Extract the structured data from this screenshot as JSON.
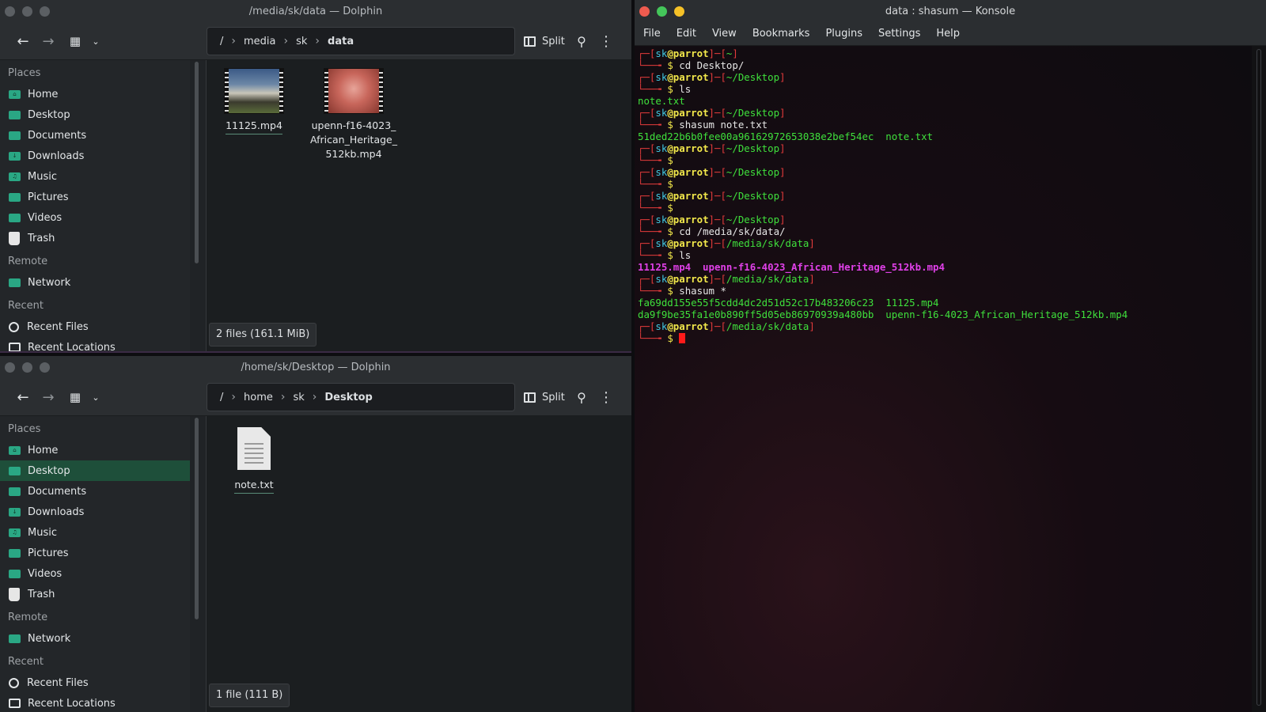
{
  "dolphin_top": {
    "title": "/media/sk/data — Dolphin",
    "breadcrumb": [
      "/",
      "media",
      "sk",
      "data"
    ],
    "split_label": "Split",
    "places_label": "Places",
    "remote_label": "Remote",
    "recent_label": "Recent",
    "places": [
      "Home",
      "Desktop",
      "Documents",
      "Downloads",
      "Music",
      "Pictures",
      "Videos",
      "Trash"
    ],
    "remote": [
      "Network"
    ],
    "recent": [
      "Recent Files",
      "Recent Locations"
    ],
    "files": [
      {
        "name": "11125.mp4"
      },
      {
        "name_lines": [
          "upenn-f16-4023_",
          "African_Heritage_",
          "512kb.mp4"
        ]
      }
    ],
    "status": "2 files (161.1 MiB)"
  },
  "dolphin_bottom": {
    "title": "/home/sk/Desktop — Dolphin",
    "breadcrumb": [
      "/",
      "home",
      "sk",
      "Desktop"
    ],
    "split_label": "Split",
    "places_label": "Places",
    "remote_label": "Remote",
    "recent_label": "Recent",
    "places": [
      "Home",
      "Desktop",
      "Documents",
      "Downloads",
      "Music",
      "Pictures",
      "Videos",
      "Trash"
    ],
    "remote": [
      "Network"
    ],
    "recent": [
      "Recent Files",
      "Recent Locations"
    ],
    "active_place": "Desktop",
    "files": [
      {
        "name": "note.txt"
      }
    ],
    "status": "1 file (111 B)"
  },
  "konsole": {
    "title": "data : shasum — Konsole",
    "menu": [
      "File",
      "Edit",
      "View",
      "Bookmarks",
      "Plugins",
      "Settings",
      "Help"
    ],
    "user": "sk",
    "host": "parrot",
    "blocks": [
      {
        "path": "~",
        "cmd": "cd Desktop/",
        "out": []
      },
      {
        "path": "~/Desktop",
        "cmd": "ls",
        "out": [
          "note.txt"
        ]
      },
      {
        "path": "~/Desktop",
        "cmd": "shasum note.txt",
        "out": [
          "51ded22b6b0fee00a96162972653038e2bef54ec  note.txt"
        ]
      },
      {
        "path": "~/Desktop",
        "cmd": "",
        "out": []
      },
      {
        "path": "~/Desktop",
        "cmd": "",
        "out": []
      },
      {
        "path": "~/Desktop",
        "cmd": "",
        "out": []
      },
      {
        "path": "~/Desktop",
        "cmd": "cd /media/sk/data/",
        "out": []
      },
      {
        "path": "/media/sk/data",
        "cmd": "ls",
        "out_magenta": "11125.mp4  upenn-f16-4023_African_Heritage_512kb.mp4"
      },
      {
        "path": "/media/sk/data",
        "cmd": "shasum *",
        "out": [
          "fa69dd155e55f5cdd4dc2d51d52c17b483206c23  11125.mp4",
          "da9f9be35fa1e0b890ff5d05eb86970939a480bb  upenn-f16-4023_African_Heritage_512kb.mp4"
        ]
      },
      {
        "path": "/media/sk/data",
        "cmd": "",
        "out": [],
        "cursor": true
      }
    ]
  }
}
